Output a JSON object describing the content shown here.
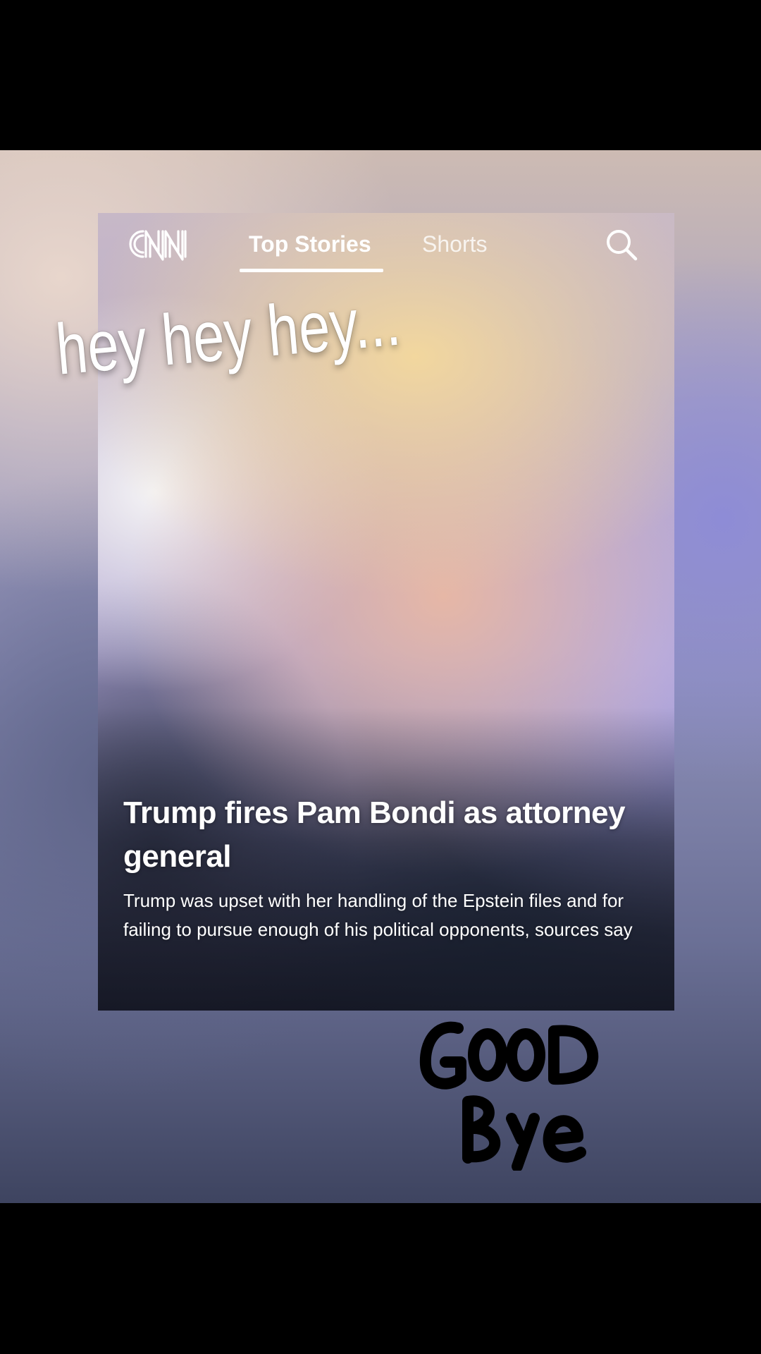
{
  "app": {
    "brand": "CNN"
  },
  "nav": {
    "tabs": [
      {
        "label": "Top Stories",
        "active": true
      },
      {
        "label": "Shorts",
        "active": false
      }
    ],
    "search_icon": "search-icon"
  },
  "story": {
    "headline": "Trump fires Pam Bondi as attorney general",
    "summary": "Trump was upset with her handling of the Epstein files and for failing to pursue enough of his political opponents, sources say"
  },
  "overlay": {
    "caption": "hey hey hey...",
    "sticker_text": "GOOD BYE"
  },
  "colors": {
    "text": "#ffffff",
    "letterbox": "#000000"
  }
}
